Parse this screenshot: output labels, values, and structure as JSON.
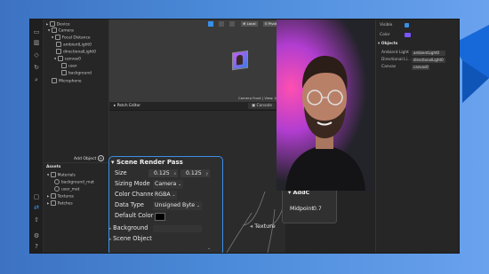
{
  "colors": {
    "accent": "#3a8fe6",
    "bg_gradient_start": "#3d72c2",
    "bg_gradient_end": "#6aa2ee",
    "panel": "#242424",
    "canvas_color_swatch": "#7a55ff"
  },
  "scene_panel": {
    "items": [
      {
        "label": "Device",
        "icon": "device-icon"
      },
      {
        "label": "Camera",
        "icon": "camera-icon"
      },
      {
        "label": "Focal Distance",
        "icon": "focal-distance-icon"
      },
      {
        "label": "ambientLight0",
        "icon": "light-icon"
      },
      {
        "label": "directionalLight0",
        "icon": "light-icon"
      },
      {
        "label": "canvas0",
        "icon": "canvas-icon"
      },
      {
        "label": "user",
        "icon": "rect-icon"
      },
      {
        "label": "background",
        "icon": "rect-icon"
      },
      {
        "label": "Microphone",
        "icon": "microphone-icon"
      }
    ],
    "add_object_label": "Add Object",
    "add_object_icon": "plus-icon"
  },
  "assets_panel": {
    "header": "Assets",
    "items": [
      {
        "label": "Materials",
        "icon": "folder-icon"
      },
      {
        "label": "background_mat",
        "icon": "material-icon"
      },
      {
        "label": "user_mat",
        "icon": "material-icon"
      },
      {
        "label": "Textures",
        "icon": "folder-icon"
      },
      {
        "label": "Patches",
        "icon": "folder-icon"
      }
    ]
  },
  "viewport": {
    "local_label": "Local",
    "pivot_label": "Pivot",
    "status": "Camera Front | View: User (Sharing)"
  },
  "patch_editor": {
    "tab_label": "Patch Editor",
    "console_label": "Console",
    "texture_port_label": "Texture",
    "add_node": {
      "title": "AddC",
      "midpoint_label": "Midpoint",
      "midpoint_value": "0.7"
    },
    "scene_render_pass": {
      "title": "Scene Render Pass",
      "size_label": "Size",
      "size_x": "0.125",
      "size_y": "0.125",
      "sizing_mode_label": "Sizing Mode",
      "sizing_mode_value": "Camera",
      "color_channel_label": "Color Channel",
      "color_channel_value": "RGBA",
      "data_type_label": "Data Type",
      "data_type_value": "Unsigned Byte",
      "default_color_label": "Default Color",
      "background_label": "Background",
      "scene_object_label": "Scene Object"
    }
  },
  "inspector": {
    "visible_label": "Visible",
    "color_label": "Color",
    "objects_header": "Objects",
    "rows": [
      {
        "label": "Ambient Light",
        "value": "ambientLight0"
      },
      {
        "label": "Directional Li...",
        "value": "directionalLight0"
      },
      {
        "label": "Canvas",
        "value": "canvas0"
      }
    ]
  }
}
